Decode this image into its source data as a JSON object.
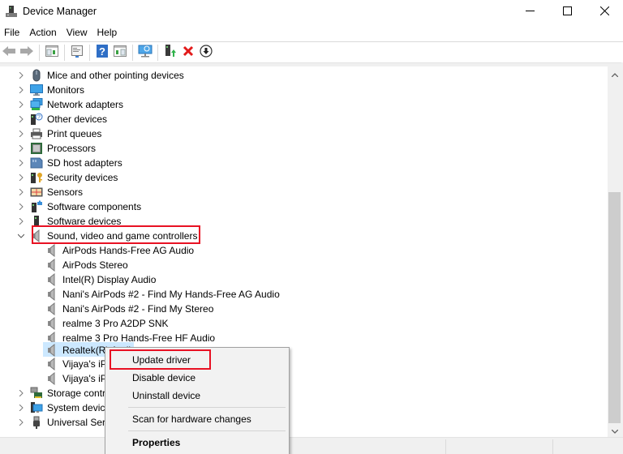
{
  "window": {
    "title": "Device Manager",
    "controls": {
      "minimize": "minimize",
      "maximize": "maximize",
      "close": "close"
    }
  },
  "menubar": {
    "items": [
      {
        "label": "File"
      },
      {
        "label": "Action"
      },
      {
        "label": "View"
      },
      {
        "label": "Help"
      }
    ]
  },
  "toolbar": {
    "buttons": [
      {
        "icon": "back-arrow-icon",
        "tooltip": "Back"
      },
      {
        "icon": "forward-arrow-icon",
        "tooltip": "Forward"
      },
      {
        "icon": "show-hide-console-tree-icon"
      },
      {
        "icon": "properties-icon"
      },
      {
        "icon": "help-icon"
      },
      {
        "icon": "show-hide-action-pane-icon"
      },
      {
        "icon": "scan-hardware-icon"
      },
      {
        "icon": "update-driver-icon"
      },
      {
        "icon": "uninstall-device-icon"
      },
      {
        "icon": "disable-device-icon"
      }
    ]
  },
  "tree": {
    "categories": [
      {
        "label": "Mice and other pointing devices",
        "icon": "mouse-icon",
        "expanded": false
      },
      {
        "label": "Monitors",
        "icon": "monitor-icon",
        "expanded": false
      },
      {
        "label": "Network adapters",
        "icon": "network-adapter-icon",
        "expanded": false
      },
      {
        "label": "Other devices",
        "icon": "unknown-device-icon",
        "expanded": false
      },
      {
        "label": "Print queues",
        "icon": "printer-icon",
        "expanded": false
      },
      {
        "label": "Processors",
        "icon": "processor-icon",
        "expanded": false
      },
      {
        "label": "SD host adapters",
        "icon": "sd-card-icon",
        "expanded": false
      },
      {
        "label": "Security devices",
        "icon": "security-key-icon",
        "expanded": false
      },
      {
        "label": "Sensors",
        "icon": "sensor-icon",
        "expanded": false
      },
      {
        "label": "Software components",
        "icon": "software-component-icon",
        "expanded": false
      },
      {
        "label": "Software devices",
        "icon": "software-device-icon",
        "expanded": false
      },
      {
        "label": "Sound, video and game controllers",
        "icon": "speaker-icon",
        "expanded": true,
        "highlighted": true
      }
    ],
    "sound_children": [
      {
        "label": "AirPods Hands-Free AG Audio"
      },
      {
        "label": "AirPods Stereo"
      },
      {
        "label": "Intel(R) Display Audio"
      },
      {
        "label": "Nani's AirPods #2 - Find My Hands-Free AG Audio"
      },
      {
        "label": "Nani's AirPods #2 - Find My Stereo"
      },
      {
        "label": "realme 3 Pro A2DP SNK"
      },
      {
        "label": "realme 3 Pro Hands-Free HF Audio"
      },
      {
        "label": "Realtek(R) Audio",
        "visible_text": "Realtek(R) Audio",
        "selected": true
      },
      {
        "label": "Vijaya's iP"
      },
      {
        "label": "Vijaya's iP"
      }
    ],
    "after_categories": [
      {
        "label": "Storage contr",
        "icon": "storage-controller-icon"
      },
      {
        "label": "System device",
        "icon": "system-device-icon"
      },
      {
        "label": "Universal Seri",
        "icon": "usb-icon"
      }
    ]
  },
  "context_menu": {
    "items": [
      {
        "label": "Update driver",
        "highlighted": true
      },
      {
        "label": "Disable device"
      },
      {
        "label": "Uninstall device"
      },
      {
        "label": "Scan for hardware changes"
      },
      {
        "label": "Properties",
        "bold": true
      }
    ]
  },
  "colors": {
    "highlight_red": "#e81123",
    "selection_blue": "#cce8ff",
    "scrollbar_thumb": "#cdcdcd"
  }
}
